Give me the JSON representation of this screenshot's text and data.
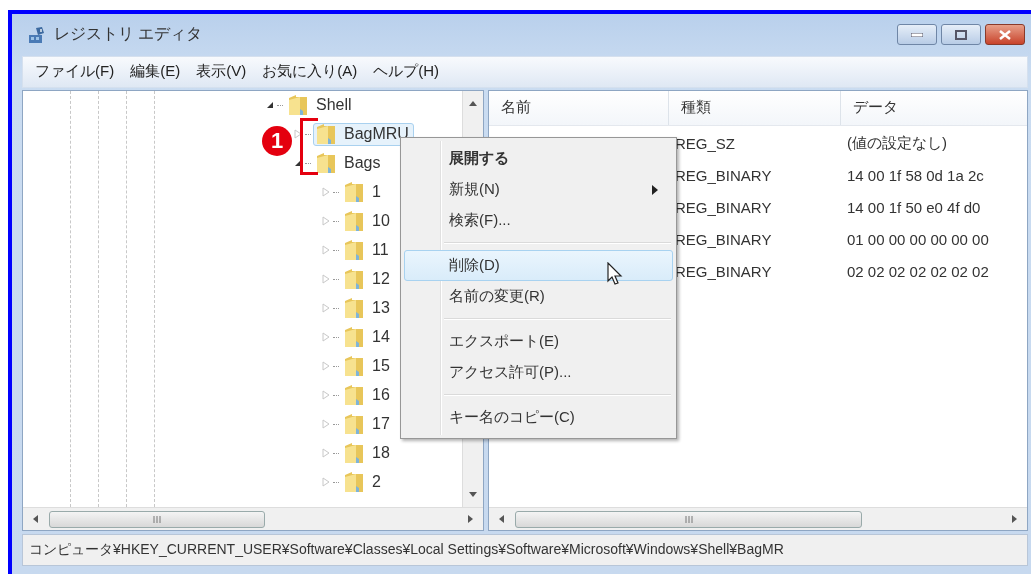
{
  "window": {
    "title": "レジストリ エディタ"
  },
  "menu_bar": [
    "ファイル(F)",
    "編集(E)",
    "表示(V)",
    "お気に入り(A)",
    "ヘルプ(H)"
  ],
  "tree": [
    {
      "label": "Shell",
      "expanded": true,
      "selected": false,
      "children": [
        {
          "label": "BagMRU",
          "expanded": false,
          "selected": true
        },
        {
          "label": "Bags",
          "expanded": true,
          "selected": false,
          "children": [
            {
              "label": "1",
              "expanded": false,
              "selected": false
            },
            {
              "label": "10",
              "expanded": false,
              "selected": false
            },
            {
              "label": "11",
              "expanded": false,
              "selected": false
            },
            {
              "label": "12",
              "expanded": false,
              "selected": false
            },
            {
              "label": "13",
              "expanded": false,
              "selected": false
            },
            {
              "label": "14",
              "expanded": false,
              "selected": false
            },
            {
              "label": "15",
              "expanded": false,
              "selected": false
            },
            {
              "label": "16",
              "expanded": false,
              "selected": false
            },
            {
              "label": "17",
              "expanded": false,
              "selected": false
            },
            {
              "label": "18",
              "expanded": false,
              "selected": false
            },
            {
              "label": "2",
              "expanded": false,
              "selected": false
            }
          ]
        }
      ]
    }
  ],
  "values_table": {
    "columns": [
      "名前",
      "種類",
      "データ"
    ],
    "rows": [
      {
        "type": "REG_SZ",
        "data": "(値の設定なし)"
      },
      {
        "type": "REG_BINARY",
        "data": "14 00 1f 58 0d 1a 2c"
      },
      {
        "type": "REG_BINARY",
        "data": "14 00 1f 50 e0 4f d0"
      },
      {
        "type": "REG_BINARY",
        "data": "01 00 00 00 00 00 00"
      },
      {
        "type": "REG_BINARY",
        "data": "02 02 02 02 02 02 02"
      }
    ]
  },
  "context_menu": {
    "groups": [
      [
        {
          "label": "展開する",
          "default": true,
          "submenu": false,
          "selected": false
        },
        {
          "label": "新規(N)",
          "default": false,
          "submenu": true,
          "selected": false
        },
        {
          "label": "検索(F)...",
          "default": false,
          "submenu": false,
          "selected": false
        }
      ],
      [
        {
          "label": "削除(D)",
          "default": false,
          "submenu": false,
          "selected": true
        },
        {
          "label": "名前の変更(R)",
          "default": false,
          "submenu": false,
          "selected": false
        }
      ],
      [
        {
          "label": "エクスポート(E)",
          "default": false,
          "submenu": false,
          "selected": false
        },
        {
          "label": "アクセス許可(P)...",
          "default": false,
          "submenu": false,
          "selected": false
        }
      ],
      [
        {
          "label": "キー名のコピー(C)",
          "default": false,
          "submenu": false,
          "selected": false
        }
      ]
    ]
  },
  "annotation": {
    "label": "1"
  },
  "status_bar": "コンピュータ¥HKEY_CURRENT_USER¥Software¥Classes¥Local Settings¥Software¥Microsoft¥Windows¥Shell¥BagMR"
}
